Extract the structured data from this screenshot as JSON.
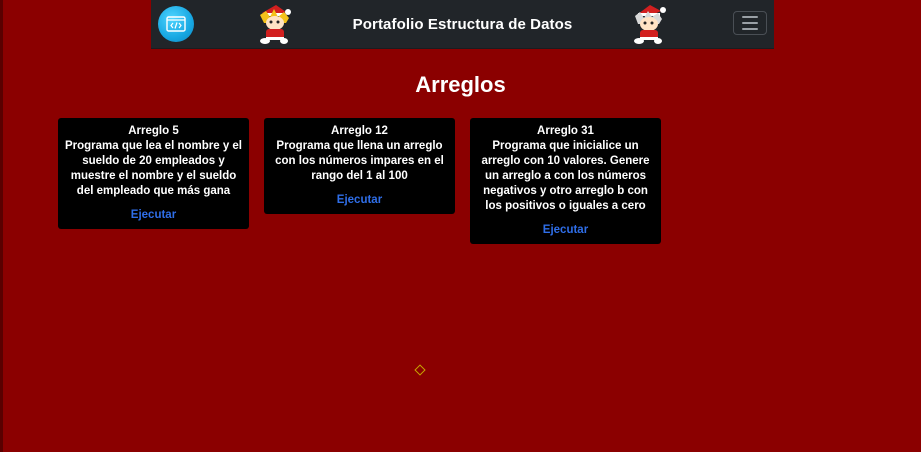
{
  "navbar": {
    "title": "Portafolio Estructura de Datos",
    "logo_icon": "code-window-icon",
    "toggler_icon": "hamburger-menu-icon"
  },
  "page": {
    "heading": "Arreglos"
  },
  "cards": [
    {
      "title": "Arreglo 5",
      "text": "Programa que lea el nombre y el sueldo de 20 empleados y muestre el nombre y el sueldo del empleado que más gana",
      "link": "Ejecutar"
    },
    {
      "title": "Arreglo 12",
      "text": "Programa que llena un arreglo con los números impares en el rango del 1 al 100",
      "link": "Ejecutar"
    },
    {
      "title": "Arreglo 31",
      "text": "Programa que inicialice un arreglo con 10 valores. Genere un arreglo a con los números negativos y otro arreglo b con los positivos o iguales a cero",
      "link": "Ejecutar"
    }
  ],
  "colors": {
    "background": "#8b0000",
    "navbar": "#212529",
    "card": "#000000",
    "link": "#2f6ee8"
  }
}
